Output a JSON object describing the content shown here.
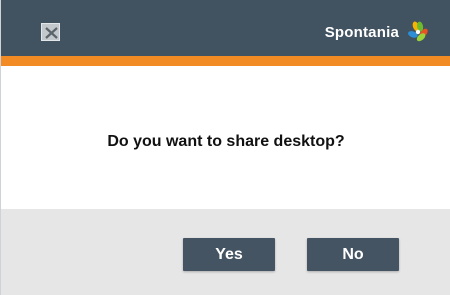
{
  "dialog": {
    "brand_name": "Spontania",
    "message": "Do you want to share desktop?",
    "yes_label": "Yes",
    "no_label": "No"
  },
  "icons": {
    "close": "close-icon",
    "brand_logo": "spontania-logo-icon"
  },
  "colors": {
    "titlebar": "#415260",
    "accent_bar": "#f28b23",
    "button": "#455462",
    "footer": "#e6e6e6"
  }
}
